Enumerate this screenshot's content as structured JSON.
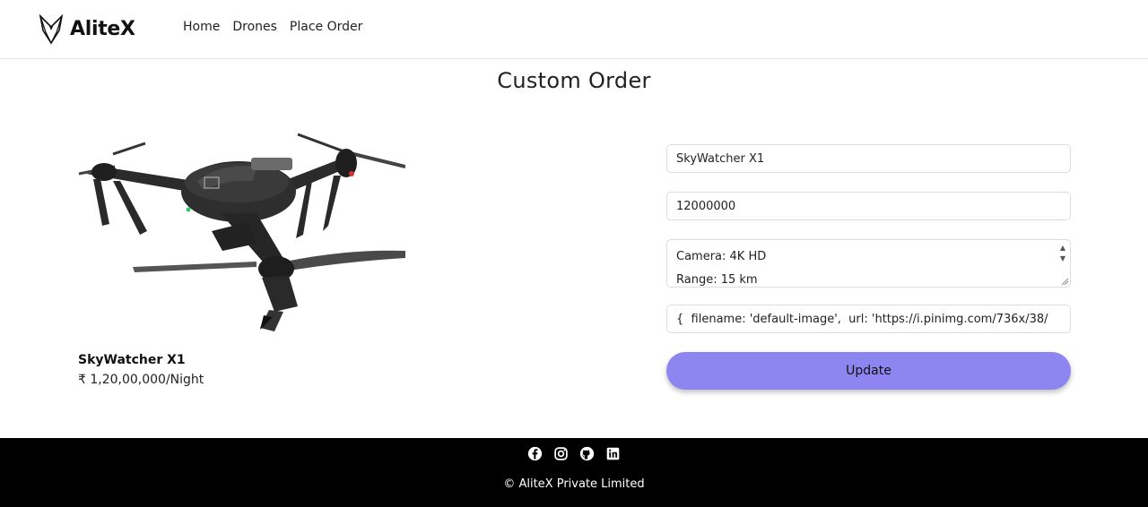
{
  "brand": {
    "name": "AliteX",
    "icon": "tuxedo-logo-icon"
  },
  "nav": {
    "items": [
      {
        "label": "Home"
      },
      {
        "label": "Drones"
      },
      {
        "label": "Place Order"
      }
    ]
  },
  "page": {
    "title": "Custom Order"
  },
  "product": {
    "name": "SkyWatcher X1",
    "price": "₹ 1,20,00,000/Night",
    "image_icon": "drone-image"
  },
  "form": {
    "name_value": "SkyWatcher X1",
    "price_value": "12000000",
    "specs_value": "Camera: 4K HD\nRange: 15 km",
    "image_value": "{  filename: 'default-image',  url: 'https://i.pinimg.com/736x/38/",
    "submit_label": "Update"
  },
  "footer": {
    "socials": [
      "facebook-icon",
      "instagram-icon",
      "github-icon",
      "linkedin-icon"
    ],
    "copyright": "© AliteX Private Limited"
  },
  "colors": {
    "button": "#8d85f0",
    "footer_bg": "#000000"
  }
}
